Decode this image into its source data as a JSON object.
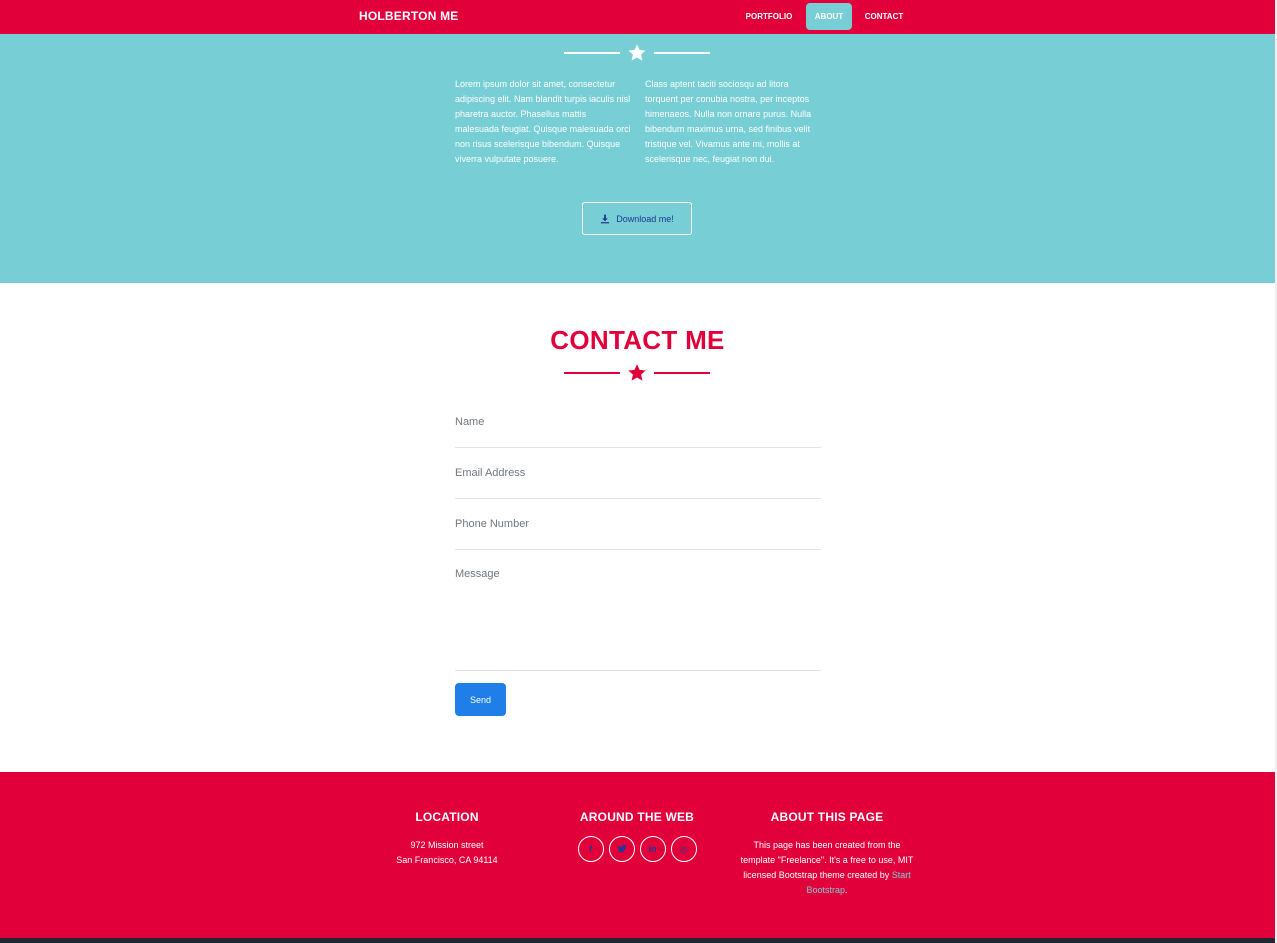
{
  "navbar": {
    "brand": "HOLBERTON ME",
    "items": [
      {
        "label": "PORTFOLIO"
      },
      {
        "label": "ABOUT",
        "active": true
      },
      {
        "label": "CONTACT"
      }
    ]
  },
  "about": {
    "col_left": "Lorem ipsum dolor sit amet, consectetur adipiscing elit. Nam blandit turpis iaculis nisl pharetra auctor. Phasellus mattis malesuada feugiat. Quisque malesuada orci non risus scelerisque bibendum. Quisque viverra vulputate posuere.",
    "col_right": "Class aptent taciti sociosqu ad litora torquent per conubia nostra, per inceptos himenaeos. Nulla non ornare purus. Nulla bibendum maximus urna, sed finibus velit tristique vel. Vivamus ante mi, mollis at scelerisque nec, feugiat non dui.",
    "download_label": "Download me!",
    "download_icon": "download-icon"
  },
  "contact": {
    "title": "CONTACT ME",
    "fields": {
      "name": "Name",
      "email": "Email Address",
      "phone": "Phone Number",
      "message": "Message"
    },
    "send_label": "Send"
  },
  "footer": {
    "location": {
      "title": "LOCATION",
      "line1": "972 Mission street",
      "line2": "San Francisco, CA 94114"
    },
    "web": {
      "title": "AROUND THE WEB",
      "icons": [
        {
          "name": "facebook-icon",
          "glyph": "f"
        },
        {
          "name": "twitter-icon",
          "glyph": "t"
        },
        {
          "name": "linkedin-icon",
          "glyph": "in"
        },
        {
          "name": "dribbble-icon",
          "glyph": "◎"
        }
      ]
    },
    "about_page": {
      "title": "ABOUT THIS PAGE",
      "text": "This page has been created from the template \"Freelance\". It's a free to use, MIT licensed Bootstrap theme created by",
      "link": "Start Bootstrap",
      "suffix": "."
    }
  },
  "colors": {
    "primary": "#e2003b",
    "teal": "#77ced4",
    "button_blue": "#1f7ee8"
  }
}
